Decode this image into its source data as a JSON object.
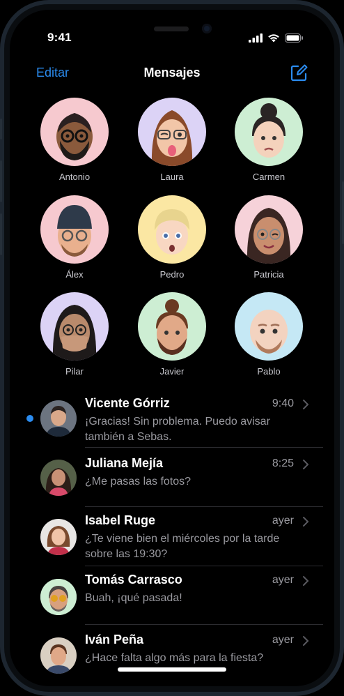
{
  "status": {
    "time": "9:41"
  },
  "nav": {
    "edit_label": "Editar",
    "title": "Mensajes"
  },
  "pinned": [
    {
      "name": "Antonio",
      "bg": "#f6c9cf"
    },
    {
      "name": "Laura",
      "bg": "#dcd3f6"
    },
    {
      "name": "Carmen",
      "bg": "#cdeed3"
    },
    {
      "name": "Álex",
      "bg": "#f6c9cf"
    },
    {
      "name": "Pedro",
      "bg": "#fbe7a3"
    },
    {
      "name": "Patricia",
      "bg": "#f6d2d9"
    },
    {
      "name": "Pilar",
      "bg": "#dcd3f6"
    },
    {
      "name": "Javier",
      "bg": "#cdeed3"
    },
    {
      "name": "Pablo",
      "bg": "#c5e8f5"
    }
  ],
  "conversations": [
    {
      "sender": "Vicente Górriz",
      "time": "9:40",
      "preview_line1": "¡Gracias! Sin problema. Puedo avisar",
      "preview_line2": "también a Sebas.",
      "unread": true
    },
    {
      "sender": "Juliana Mejía",
      "time": "8:25",
      "preview_line1": "¿Me pasas las fotos?",
      "preview_line2": "",
      "unread": false
    },
    {
      "sender": "Isabel Ruge",
      "time": "ayer",
      "preview_line1": "¿Te viene bien el miércoles por la tarde",
      "preview_line2": "sobre las 19:30?",
      "unread": false
    },
    {
      "sender": "Tomás Carrasco",
      "time": "ayer",
      "preview_line1": "Buah, ¡qué pasada!",
      "preview_line2": "",
      "unread": false
    },
    {
      "sender": "Iván Peña",
      "time": "ayer",
      "preview_line1": "¿Hace falta algo más para la fiesta?",
      "preview_line2": "",
      "unread": false
    }
  ],
  "colors": {
    "accent": "#2b8cf0",
    "background": "#000000",
    "secondary_text": "#9a9aa0"
  }
}
